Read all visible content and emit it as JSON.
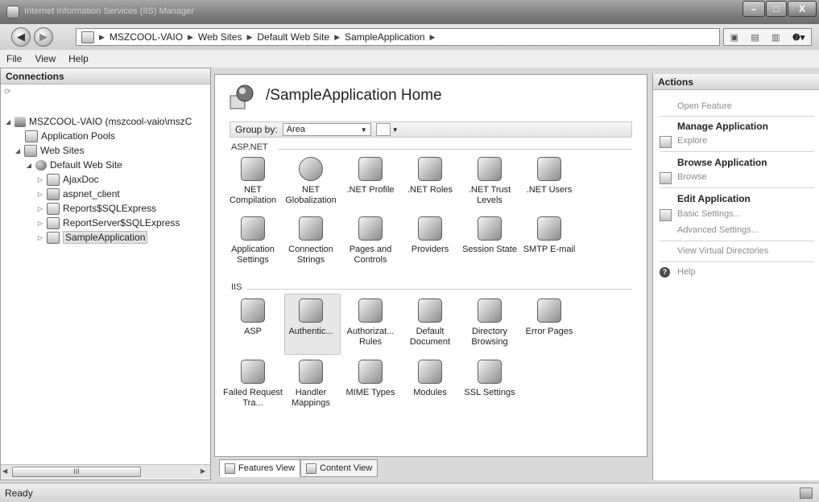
{
  "window": {
    "title": "Internet Information Services (IIS) Manager",
    "minimize": "–",
    "maximize": "□",
    "close": "X"
  },
  "address": {
    "crumbs": [
      "MSZCOOL-VAIO",
      "Web Sites",
      "Default Web Site",
      "SampleApplication"
    ]
  },
  "menu": {
    "file": "File",
    "view": "View",
    "help": "Help"
  },
  "connections": {
    "title": "Connections",
    "tree": [
      {
        "label": "MSZCOOL-VAIO (mszcool-vaio\\mszC",
        "level": 0
      },
      {
        "label": "Application Pools",
        "level": 1
      },
      {
        "label": "Web Sites",
        "level": 1
      },
      {
        "label": "Default Web Site",
        "level": 2
      },
      {
        "label": "AjaxDoc",
        "level": 3
      },
      {
        "label": "aspnet_client",
        "level": 3
      },
      {
        "label": "Reports$SQLExpress",
        "level": 3
      },
      {
        "label": "ReportServer$SQLExpress",
        "level": 3
      },
      {
        "label": "SampleApplication",
        "level": 3
      }
    ],
    "scroll_label": "III"
  },
  "center": {
    "title": "/SampleApplication Home",
    "group_by_label": "Group by:",
    "group_by_value": "Area",
    "sections": {
      "aspnet": "ASP.NET",
      "iis": "IIS"
    },
    "aspnet_features": [
      "NET Compilation",
      "NET Globalization",
      ".NET Profile",
      ".NET Roles",
      ".NET Trust Levels",
      ".NET Users",
      "Application Settings",
      "Connection Strings",
      "Pages and Controls",
      "Providers",
      "Session State",
      "SMTP E-mail"
    ],
    "iis_features": [
      "ASP",
      "Authentic...",
      "Authorizat... Rules",
      "Default Document",
      "Directory Browsing",
      "Error Pages",
      "Failed Request Tra...",
      "Handler Mappings",
      "MIME Types",
      "Modules",
      "SSL Settings"
    ]
  },
  "tabs": {
    "features_view": "Features View",
    "content_view": "Content View"
  },
  "actions": {
    "title": "Actions",
    "open_feature": "Open Feature",
    "manage_application": "Manage Application",
    "explore": "Explore",
    "browse_application": "Browse Application",
    "browse": "Browse",
    "edit_application": "Edit Application",
    "basic_settings": "Basic Settings...",
    "advanced_settings": "Advanced Settings...",
    "view_virtual_directories": "View Virtual Directories",
    "help": "Help"
  },
  "status": {
    "text": "Ready"
  }
}
